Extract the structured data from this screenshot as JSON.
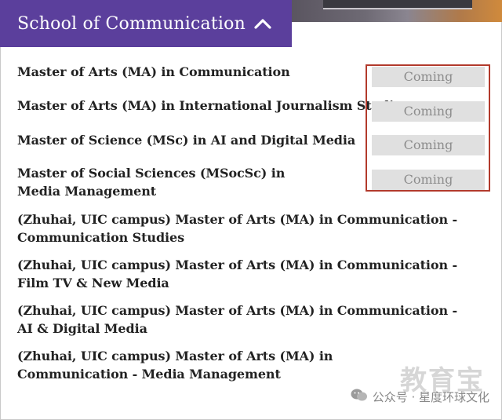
{
  "header": {
    "title": "School of Communication",
    "expanded": true
  },
  "programs": [
    {
      "name": "Master of Arts (MA) in Communication",
      "status": "Coming"
    },
    {
      "name": "Master of Arts (MA) in International Journalism Studies",
      "status": "Coming"
    },
    {
      "name": "Master of Science (MSc) in AI and Digital Media",
      "status": "Coming"
    },
    {
      "name": "Master of Social Sciences (MSocSc) in Media Management",
      "status": "Coming"
    },
    {
      "name": "(Zhuhai, UIC campus) Master of Arts (MA) in Communication - Communication Studies"
    },
    {
      "name": "(Zhuhai, UIC campus) Master of Arts (MA) in Communication - Film TV & New Media"
    },
    {
      "name": "(Zhuhai, UIC campus) Master of Arts (MA) in Communication - AI & Digital Media"
    },
    {
      "name": "(Zhuhai, UIC campus) Master of Arts (MA) in Communication - Media Management"
    }
  ],
  "watermark": {
    "logo_text": "教育宝",
    "caption": "公众号 · 星度环球文化"
  },
  "colors": {
    "header_bg": "#5b3f9c",
    "highlight_border": "#b23a2c",
    "coming_bg": "#e0e0e0"
  }
}
